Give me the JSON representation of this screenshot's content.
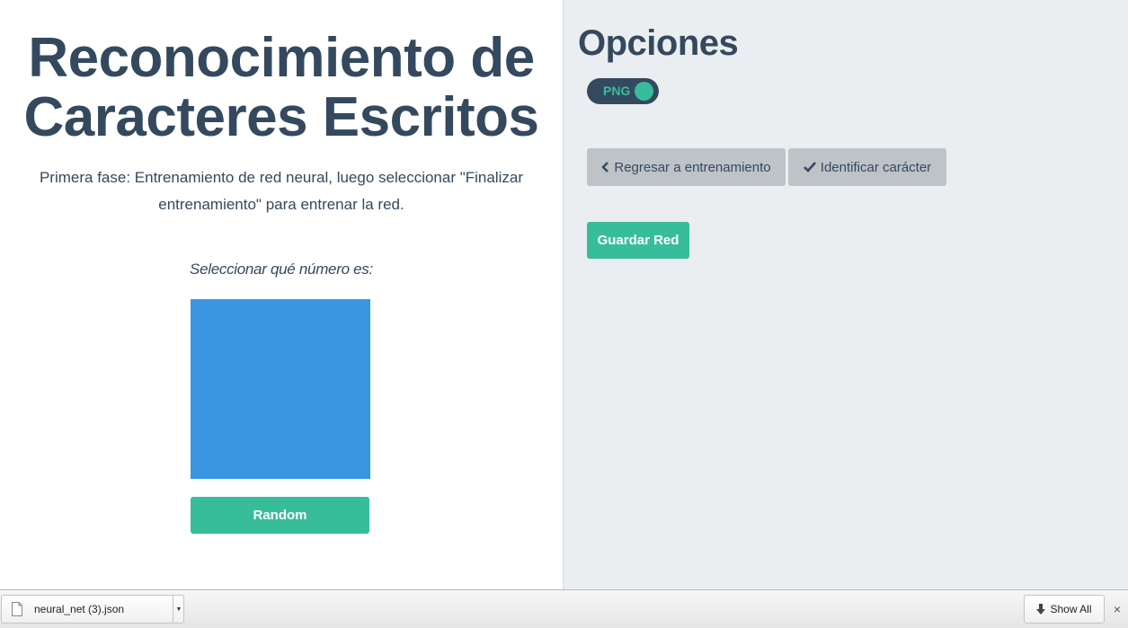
{
  "left": {
    "title_line1": "Reconocimiento de",
    "title_line2": "Caracteres Escritos",
    "instructions": "Primera fase: Entrenamiento de red neural, luego seleccionar \"Finalizar entrenamiento\" para entrenar la red.",
    "select_label": "Seleccionar qué número es:",
    "random_button": "Random"
  },
  "right": {
    "title": "Opciones",
    "toggle_label": "PNG",
    "toggle_on": true,
    "back_button": "Regresar a entrenamiento",
    "identify_button": "Identificar carácter",
    "save_button": "Guardar Red"
  },
  "download_bar": {
    "file_name": "neural_net (3).json",
    "show_all": "Show All",
    "close": "×"
  },
  "colors": {
    "primary": "#34495e",
    "accent": "#37bd9a",
    "canvas": "#3a96e0",
    "button_gray": "#bdc3c7",
    "panel_bg": "#ebeef0"
  },
  "icons": [
    "chevron-left-icon",
    "checkmark-icon",
    "file-icon",
    "dropdown-arrow-icon",
    "download-arrow-icon",
    "close-icon"
  ]
}
